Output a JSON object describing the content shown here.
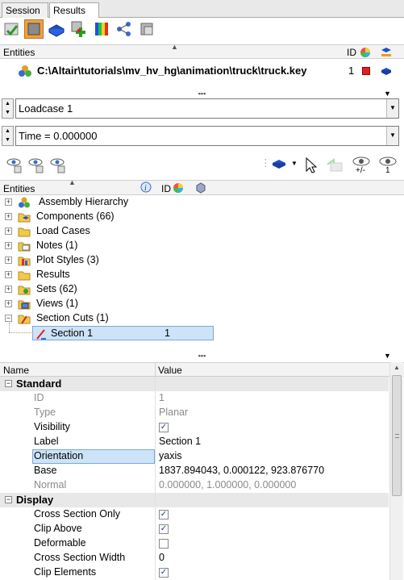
{
  "tabs": [
    {
      "label": "Session"
    },
    {
      "label": "Results",
      "close": "✕"
    }
  ],
  "results_header": {
    "entities": "Entities",
    "id": "ID"
  },
  "results_row": {
    "path": "C:\\Altair\\tutorials\\mv_hv_hg\\animation\\truck\\truck.key",
    "id": "1"
  },
  "loadcase": {
    "value": "Loadcase 1"
  },
  "time": {
    "value": "Time = 0.000000"
  },
  "entity_header": {
    "entities": "Entities",
    "id": "ID"
  },
  "tree": [
    {
      "label": "Assembly Hierarchy"
    },
    {
      "label": "Components (66)"
    },
    {
      "label": "Load Cases"
    },
    {
      "label": "Notes (1)"
    },
    {
      "label": "Plot Styles (3)"
    },
    {
      "label": "Results"
    },
    {
      "label": "Sets  (62)"
    },
    {
      "label": "Views (1)"
    },
    {
      "label": "Section Cuts (1)"
    }
  ],
  "selected_item": {
    "label": "Section 1",
    "id": "1"
  },
  "props_header": {
    "name": "Name",
    "value": "Value"
  },
  "standard": {
    "title": "Standard",
    "id": {
      "name": "ID",
      "value": "1"
    },
    "type": {
      "name": "Type",
      "value": "Planar"
    },
    "visibility": {
      "name": "Visibility"
    },
    "label": {
      "name": "Label",
      "value": "Section 1"
    },
    "orientation": {
      "name": "Orientation",
      "value": "yaxis"
    },
    "base": {
      "name": "Base",
      "value": "1837.894043, 0.000122, 923.876770"
    },
    "normal": {
      "name": "Normal",
      "value": "0.000000, 1.000000, 0.000000"
    }
  },
  "display": {
    "title": "Display",
    "cross_section_only": {
      "name": "Cross Section Only"
    },
    "clip_above": {
      "name": "Clip Above"
    },
    "deformable": {
      "name": "Deformable"
    },
    "cross_section_width": {
      "name": "Cross Section Width",
      "value": "0"
    },
    "clip_elements": {
      "name": "Clip Elements"
    }
  },
  "colors": {
    "selection": "#cde3f7",
    "accent": "#e02020"
  }
}
